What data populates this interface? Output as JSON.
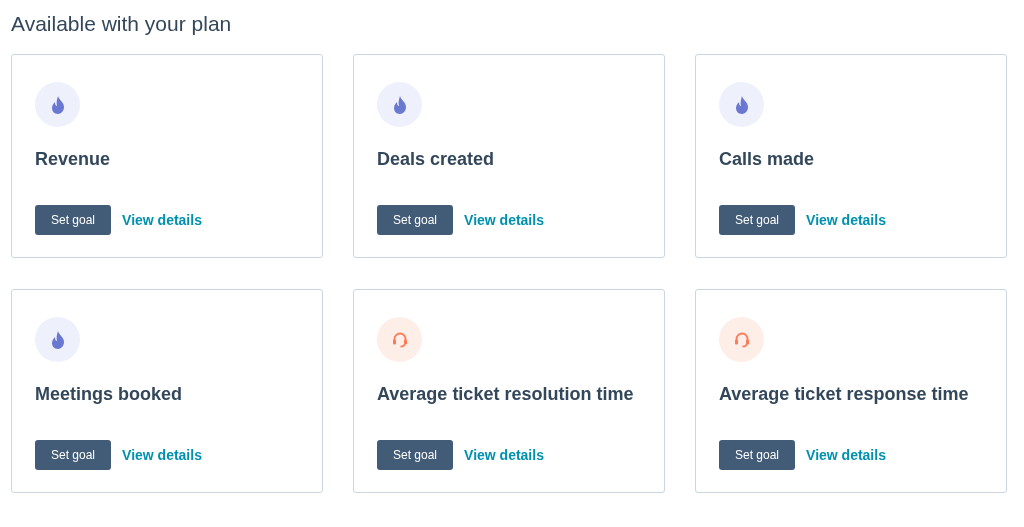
{
  "heading": "Available with your plan",
  "cards": [
    {
      "kind": "sales",
      "title": "Revenue",
      "button": "Set goal",
      "link": "View details"
    },
    {
      "kind": "sales",
      "title": "Deals created",
      "button": "Set goal",
      "link": "View details"
    },
    {
      "kind": "sales",
      "title": "Calls made",
      "button": "Set goal",
      "link": "View details"
    },
    {
      "kind": "sales",
      "title": "Meetings booked",
      "button": "Set goal",
      "link": "View details"
    },
    {
      "kind": "service",
      "title": "Average ticket resolution time",
      "button": "Set goal",
      "link": "View details"
    },
    {
      "kind": "service",
      "title": "Average ticket response time",
      "button": "Set goal",
      "link": "View details"
    }
  ]
}
